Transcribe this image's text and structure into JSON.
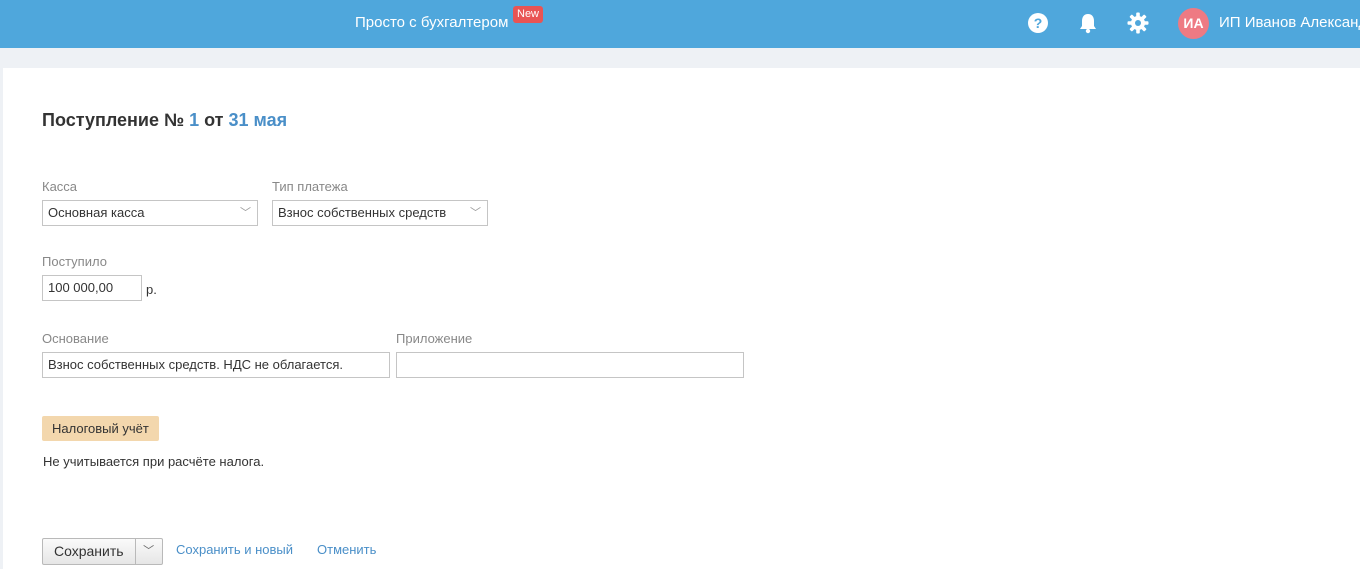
{
  "header": {
    "app_link": "Просто с бухгалтером",
    "new_badge": "New",
    "avatar_initials": "ИА",
    "user_name": "ИП Иванов Александ",
    "icons": [
      "help-icon",
      "bell-icon",
      "gear-icon"
    ]
  },
  "document": {
    "title_prefix": "Поступление №",
    "number": "1",
    "title_from": "от",
    "date": "31 мая"
  },
  "form": {
    "kassa_label": "Касса",
    "kassa_value": "Основная касса",
    "payment_type_label": "Тип платежа",
    "payment_type_value": "Взнос собственных средств",
    "received_label": "Поступило",
    "received_value": "100 000,00",
    "currency_unit": "р.",
    "basis_label": "Основание",
    "basis_value": "Взнос собственных средств. НДС не облагается.",
    "attachment_label": "Приложение",
    "attachment_value": ""
  },
  "tax": {
    "badge": "Налоговый учёт",
    "text": "Не учитывается при расчёте налога."
  },
  "actions": {
    "save": "Сохранить",
    "save_and_new": "Сохранить и новый",
    "cancel": "Отменить"
  },
  "colors": {
    "header_bg": "#4fa7dc",
    "link": "#4a8fc8",
    "badge_new": "#e95454",
    "avatar_bg": "#ee7a83",
    "tax_badge_bg": "#f3d7ad"
  }
}
